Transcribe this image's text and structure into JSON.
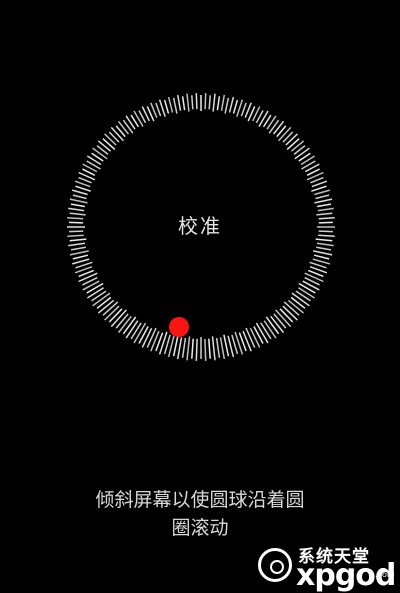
{
  "dial": {
    "label": "校准",
    "tick_count": 180,
    "tick_color": "#ffffff",
    "ball_color": "#ff1414"
  },
  "instruction": {
    "line1": "倾斜屏幕以使圆球沿着圆",
    "line2": "圈滚动"
  },
  "watermark": {
    "chinese": "系统天堂",
    "latin": "xpgod",
    "suffix": ".com"
  }
}
